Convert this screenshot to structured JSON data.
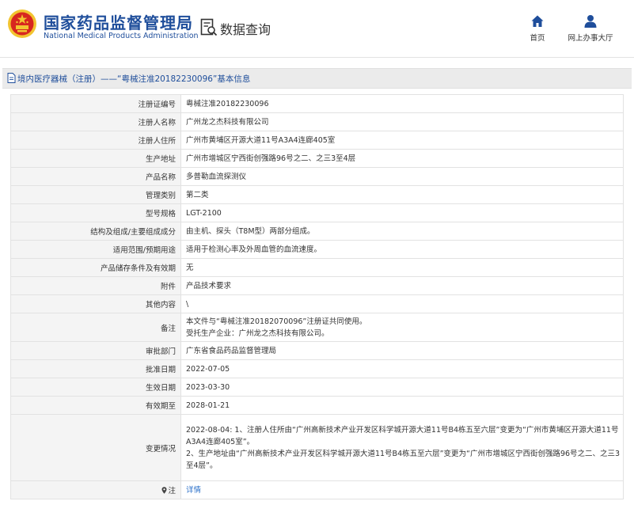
{
  "header": {
    "title_cn": "国家药品监督管理局",
    "title_en": "National Medical Products Administration",
    "query_label": "数据查询",
    "nav": [
      {
        "label": "首页",
        "icon": "home-icon"
      },
      {
        "label": "网上办事大厅",
        "icon": "user-icon"
      }
    ]
  },
  "breadcrumb": {
    "text": "境内医疗器械（注册）——“粤械注准20182230096”基本信息",
    "icon": "document-icon"
  },
  "table": {
    "rows": [
      {
        "label": "注册证编号",
        "value": "粤械注准20182230096"
      },
      {
        "label": "注册人名称",
        "value": "广州龙之杰科技有限公司"
      },
      {
        "label": "注册人住所",
        "value": "广州市黄埔区开源大道11号A3A4连廊405室"
      },
      {
        "label": "生产地址",
        "value": "广州市增城区宁西街创强路96号之二、之三3至4层"
      },
      {
        "label": "产品名称",
        "value": "多普勒血流探测仪"
      },
      {
        "label": "管理类别",
        "value": "第二类"
      },
      {
        "label": "型号规格",
        "value": "LGT-2100"
      },
      {
        "label": "结构及组成/主要组成成分",
        "value": "由主机、探头（T8M型）两部分组成。"
      },
      {
        "label": "适用范围/预期用途",
        "value": "适用于检测心率及外周血管的血流速度。"
      },
      {
        "label": "产品储存条件及有效期",
        "value": "无"
      },
      {
        "label": "附件",
        "value": "产品技术要求"
      },
      {
        "label": "其他内容",
        "value": "\\"
      },
      {
        "label": "备注",
        "lines": [
          "本文件与“粤械注准20182070096”注册证共同使用。",
          "受托生产企业：广州龙之杰科技有限公司。"
        ]
      },
      {
        "label": "审批部门",
        "value": "广东省食品药品监督管理局"
      },
      {
        "label": "批准日期",
        "value": "2022-07-05"
      },
      {
        "label": "生效日期",
        "value": "2023-03-30"
      },
      {
        "label": "有效期至",
        "value": "2028-01-21"
      },
      {
        "label": "变更情况",
        "lines": [
          "2022-08-04: 1、注册人住所由“广州高新技术产业开发区科学城开源大道11号B4栋五至六层”变更为“广州市黄埔区开源大道11号",
          "A3A4连廊405室”。",
          "2、生产地址由“广州高新技术产业开发区科学城开源大道11号B4栋五至六层”变更为“广州市增城区宁西街创强路96号之二、之三3",
          "至4层”。"
        ]
      }
    ],
    "note": {
      "label": "注",
      "link": "详情",
      "icon": "location-pin-icon"
    }
  },
  "colors": {
    "brand_blue": "#1f4e9b",
    "link_blue": "#2a6fc9",
    "emblem_red": "#d7261f",
    "emblem_gold": "#f2c430"
  }
}
